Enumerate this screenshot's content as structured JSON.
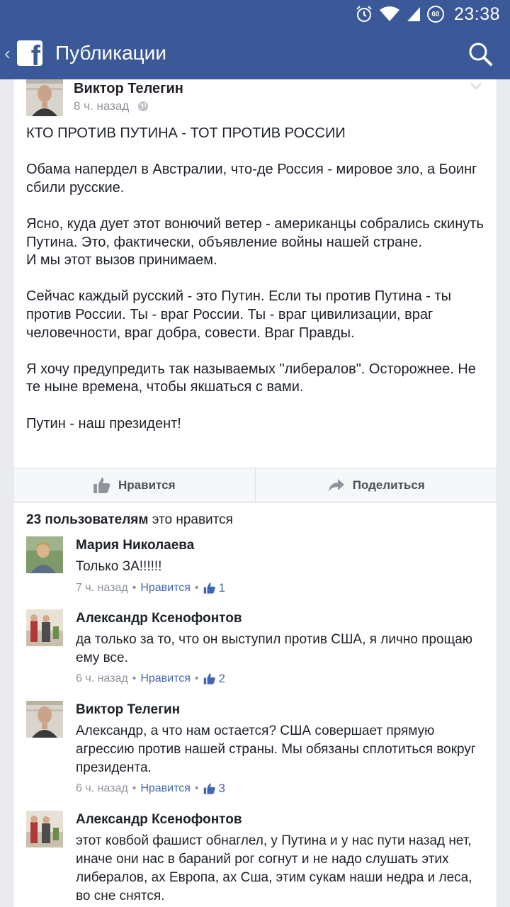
{
  "status_bar": {
    "time": "23:38",
    "network_badge": "60"
  },
  "app_bar": {
    "logo_letter": "f",
    "title": "Публикации"
  },
  "post": {
    "author": "Виктор Телегин",
    "time": "8 ч. назад",
    "paragraphs": [
      "КТО ПРОТИВ ПУТИНА - ТОТ ПРОТИВ РОССИИ",
      "Обама напердел в Австралии, что-де Россия - мировое зло, а Боинг сбили русские.",
      "Ясно, куда дует этот вонючий ветер - американцы собрались скинуть Путина. Это, фактически, объявление войны нашей стране.\nИ мы этот вызов принимаем.",
      "Сейчас каждый русский - это Путин. Если ты против Путина - ты против России. Ты - враг России. Ты - враг цивилизации, враг человечности, враг добра, совести. Враг Правды.",
      "Я хочу предупредить так называемых \"либералов\". Осторожнее. Не те ныне времена, чтобы якшаться с вами.",
      "Путин - наш президент!"
    ],
    "actions": {
      "like": "Нравится",
      "share": "Поделиться"
    }
  },
  "likes_summary": {
    "count_text": "23 пользователям",
    "rest_text": " это нравится"
  },
  "comments": [
    {
      "name": "Мария Николаева",
      "text": "Только ЗА!!!!!!",
      "time": "7 ч. назад",
      "like_label": "Нравится",
      "likes": "1"
    },
    {
      "name": "Александр Ксенофонтов",
      "text": "да только за то, что он выступил против США, я лично прощаю ему все.",
      "time": "6 ч. назад",
      "like_label": "Нравится",
      "likes": "2"
    },
    {
      "name": "Виктор Телегин",
      "text": "Александр, а что нам остается? США совершает прямую агрессию против нашей страны. Мы обязаны сплотиться вокруг президента.",
      "time": "6 ч. назад",
      "like_label": "Нравится",
      "likes": "3"
    },
    {
      "name": "Александр Ксенофонтов",
      "text": "этот ковбой фашист обнаглел, у Путина и у нас пути назад нет, иначе они нас в бараний рог согнут и не надо слушать этих либералов, ах Европа, ах Сша, этим сукам наши недра и леса, во сне снятся.",
      "time": "",
      "like_label": "",
      "likes": ""
    }
  ],
  "colors": {
    "brand": "#3b5998",
    "link": "#4267b2",
    "meta": "#90949c",
    "text": "#1d2129",
    "background": "#e9ebee"
  },
  "icons": [
    "alarm-icon",
    "wifi-icon",
    "signal-icon",
    "back-icon",
    "facebook-logo-icon",
    "search-icon",
    "globe-icon",
    "chevron-down-icon",
    "thumbs-up-icon",
    "share-arrow-icon"
  ]
}
